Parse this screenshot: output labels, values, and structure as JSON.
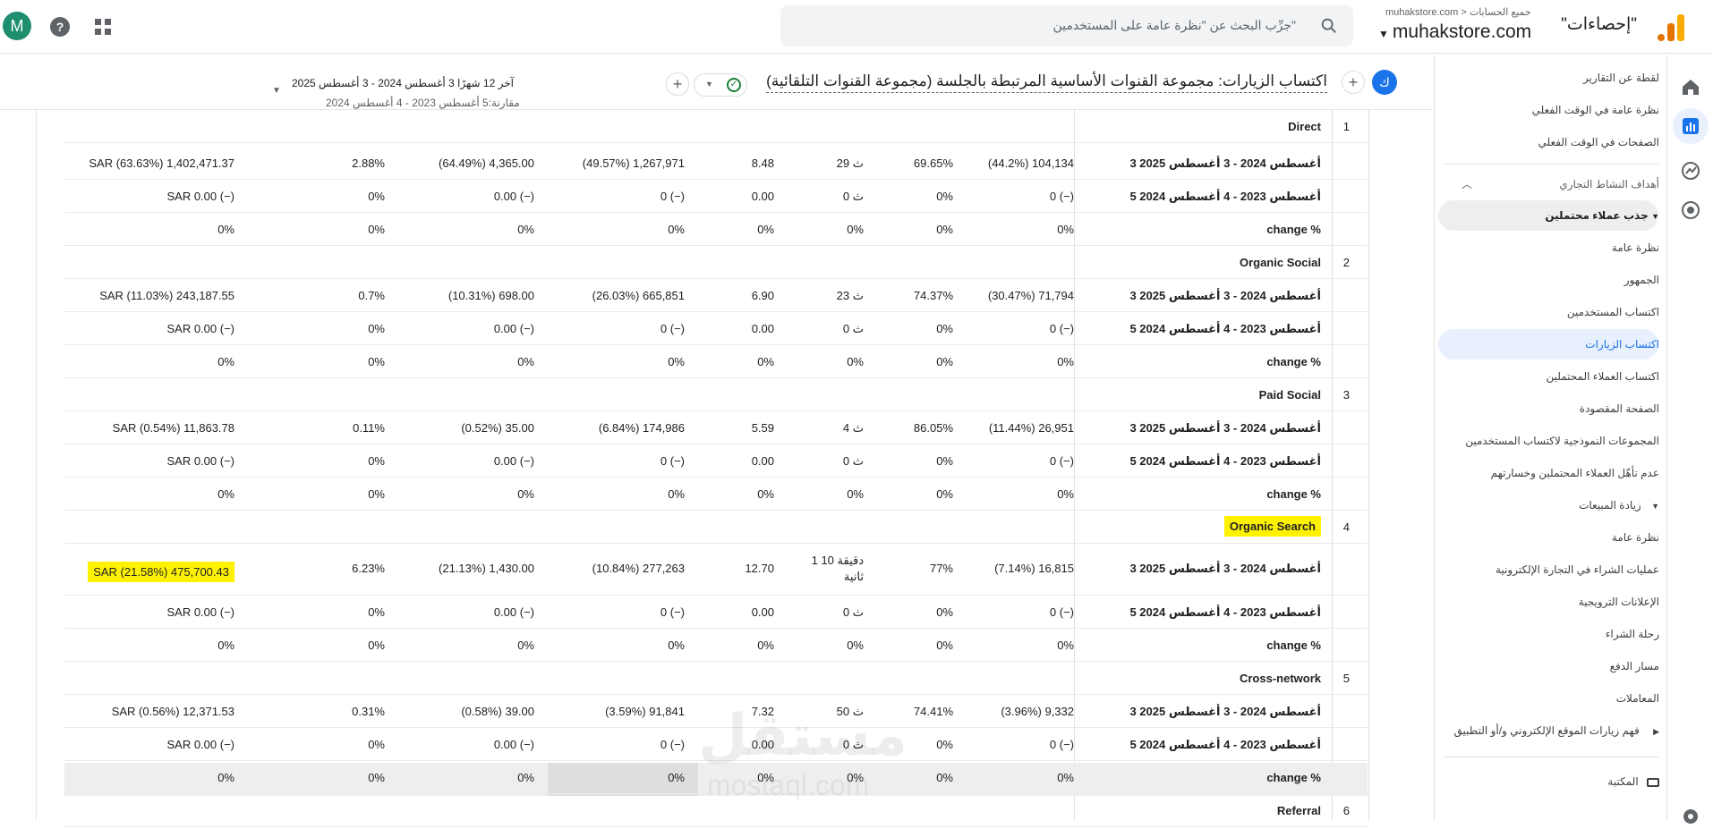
{
  "header": {
    "property_title": "\"إحصاءات\"",
    "account_crumb": "muhakstore.com  >  جميع الحسابات",
    "account_name": "muhakstore.com",
    "search_placeholder": "جرِّب البحث عن \"نظرة عامة على المستخدمين\"",
    "avatar_letter": "M"
  },
  "sidebar": {
    "top_items": [
      "لقطة عن التقارير",
      "نظرة عامة في الوقت الفعلي",
      "الصفحات في الوقت الفعلي"
    ],
    "section_business": "أهداف النشاط التجاري",
    "group_leads": "جذب عملاء محتملين",
    "leads_items": [
      "نظرة عامة",
      "الجمهور",
      "اكتساب المستخدمين",
      "اكتساب الزيارات",
      "اكتساب العملاء المحتملين",
      "الصفحة المقصودة",
      "المجموعات النموذجية لاكتساب المستخدمين",
      "عدم تأهّل العملاء المحتملين وخسارتهم"
    ],
    "group_sales": "زيادة المبيعات",
    "sales_items": [
      "نظرة عامة",
      "عمليات الشراء في التجارة الإلكترونية",
      "الإعلانات الترويجية",
      "رحلة الشراء",
      "مسار الدفع",
      "المعاملات"
    ],
    "group_understand": "فهم زيارات الموقع الإلكتروني و/أو التطبيق",
    "library": "المكتبة"
  },
  "report": {
    "title": "اكتساب الزيارات: مجموعة القنوات الأساسية المرتبطة بالجلسة (مجموعة القنوات التلقائية)",
    "badge": "ك",
    "date_range": "آخر 12 شهرًا  3 أغسطس 2024 - 3 أغسطس 2025",
    "compare_range": "مقارنة:5 أغسطس 2023 - 4 أغسطس 2024"
  },
  "table": {
    "period_labels": {
      "current": "3 أغسطس 2024 - 3 أغسطس 2025",
      "previous": "5 أغسطس 2023 - 4 أغسطس 2024",
      "change": "change %"
    },
    "groups": [
      {
        "index": "1",
        "channel": "Direct",
        "highlight": false,
        "current": [
          "(44.2%) 104,134",
          "69.65%",
          "29 ث",
          "8.48",
          "(49.57%) 1,267,971",
          "(64.49%) 4,365.00",
          "2.88%",
          "SAR (63.63%) 1,402,471.37"
        ],
        "previous": [
          "0 (−)",
          "0%",
          "0 ث",
          "0.00",
          "0 (−)",
          "0.00 (−)",
          "0%",
          "SAR 0.00 (−)"
        ],
        "change": [
          "0%",
          "0%",
          "0%",
          "0%",
          "0%",
          "0%",
          "0%",
          "0%"
        ]
      },
      {
        "index": "2",
        "channel": "Organic Social",
        "highlight": false,
        "current": [
          "(30.47%) 71,794",
          "74.37%",
          "23 ث",
          "6.90",
          "(26.03%) 665,851",
          "(10.31%) 698.00",
          "0.7%",
          "SAR (11.03%) 243,187.55"
        ],
        "previous": [
          "0 (−)",
          "0%",
          "0 ث",
          "0.00",
          "0 (−)",
          "0.00 (−)",
          "0%",
          "SAR 0.00 (−)"
        ],
        "change": [
          "0%",
          "0%",
          "0%",
          "0%",
          "0%",
          "0%",
          "0%",
          "0%"
        ]
      },
      {
        "index": "3",
        "channel": "Paid Social",
        "highlight": false,
        "current": [
          "(11.44%) 26,951",
          "86.05%",
          "4 ث",
          "5.59",
          "(6.84%) 174,986",
          "(0.52%) 35.00",
          "0.11%",
          "SAR (0.54%) 11,863.78"
        ],
        "previous": [
          "0 (−)",
          "0%",
          "0 ث",
          "0.00",
          "0 (−)",
          "0.00 (−)",
          "0%",
          "SAR 0.00 (−)"
        ],
        "change": [
          "0%",
          "0%",
          "0%",
          "0%",
          "0%",
          "0%",
          "0%",
          "0%"
        ]
      },
      {
        "index": "4",
        "channel": "Organic Search",
        "highlight": true,
        "current": [
          "(7.14%) 16,815",
          "77%",
          "1 دقيقة 10 ثانية",
          "12.70",
          "(10.84%) 277,263",
          "(21.13%) 1,430.00",
          "6.23%",
          "SAR (21.58%) 475,700.43"
        ],
        "previous": [
          "0 (−)",
          "0%",
          "0 ث",
          "0.00",
          "0 (−)",
          "0.00 (−)",
          "0%",
          "SAR 0.00 (−)"
        ],
        "change": [
          "0%",
          "0%",
          "0%",
          "0%",
          "0%",
          "0%",
          "0%",
          "0%"
        ]
      },
      {
        "index": "5",
        "channel": "Cross-network",
        "highlight": false,
        "current": [
          "(3.96%) 9,332",
          "74.41%",
          "50 ث",
          "7.32",
          "(3.59%) 91,841",
          "(0.58%) 39.00",
          "0.31%",
          "SAR (0.56%) 12,371.53"
        ],
        "previous": [
          "0 (−)",
          "0%",
          "0 ث",
          "0.00",
          "0 (−)",
          "0.00 (−)",
          "0%",
          "SAR 0.00 (−)"
        ],
        "change": [
          "0%",
          "0%",
          "0%",
          "0%",
          "0%",
          "0%",
          "0%",
          "0%"
        ]
      },
      {
        "index": "6",
        "channel": "Referral",
        "highlight": false,
        "current": [],
        "previous": [],
        "change": []
      }
    ]
  },
  "watermark": {
    "brand": "مستقل",
    "site": "mostaql.com"
  },
  "colors": {
    "accent": "#1a73e8",
    "highlight": "#fff200",
    "logo_orange": "#f9ab00"
  }
}
